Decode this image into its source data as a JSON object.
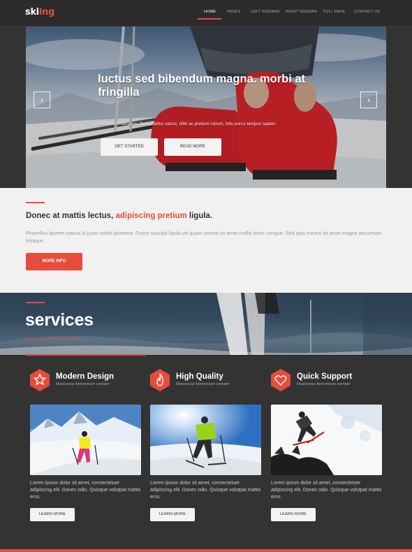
{
  "logo": {
    "part1": "ski",
    "part2": "ing"
  },
  "nav": {
    "items": [
      {
        "label": "HOME",
        "active": true
      },
      {
        "label": "PAGES",
        "active": false
      },
      {
        "label": "LEFT SIDEBAR",
        "active": false
      },
      {
        "label": "RIGHT SIDEBAR",
        "active": false
      },
      {
        "label": "FULL PAGE",
        "active": false
      },
      {
        "label": "CONTACT US",
        "active": false
      }
    ]
  },
  "hero": {
    "title": "luctus sed bibendum magna. morbi at fringilla",
    "subtitle": "Inceptos himenaeos. Sed ... tellus varius, nibh ac pretium rutrum, felis purus tempus sapien.",
    "button_primary": "GET STARTED",
    "button_secondary": "READ MORE",
    "prev_icon": "chevron-left-icon",
    "next_icon": "chevron-right-icon"
  },
  "intro": {
    "heading_start": "Donec at mattis lectus, ",
    "heading_accent": "adipiscing pretium",
    "heading_end": " ligula.",
    "text": "Phasellus laoreet massa id justo mattis pharetra. Fusce suscipit ligula vel quam viverra sit amet mollis tortor congue. Sed quis mauris sit amet magna accumsan tristique.",
    "button": "MORE INFO"
  },
  "services": {
    "title": "services",
    "subtitle": "Lorem ipsum dolor sit nulla"
  },
  "cards": [
    {
      "icon": "star-icon",
      "title": "Modern Design",
      "subtitle": "Maecenas fermentum semper",
      "text": "Lorem ipsum dolor sit amet, consectetuer adipiscing elit. Donec odio. Quisque volutpat mattis eros.",
      "button": "LEARN MORE"
    },
    {
      "icon": "flame-icon",
      "title": "High Quality",
      "subtitle": "Maecenas fermentum semper",
      "text": "Lorem ipsum dolor sit amet, consectetuer adipiscing elit. Donec odio. Quisque volutpat mattis eros.",
      "button": "LEARN MORE"
    },
    {
      "icon": "heart-icon",
      "title": "Quick Support",
      "subtitle": "Maecenas fermentum semper",
      "text": "Lorem ipsum dolor sit amet, consectetuer adipiscing elit. Donec odio. Quisque volutpat mattis eros.",
      "button": "LEARN MORE"
    }
  ],
  "colors": {
    "accent": "#e74c3c",
    "background": "#333333",
    "header": "#2b2b2b",
    "intro_bg": "#f1f1f1"
  }
}
